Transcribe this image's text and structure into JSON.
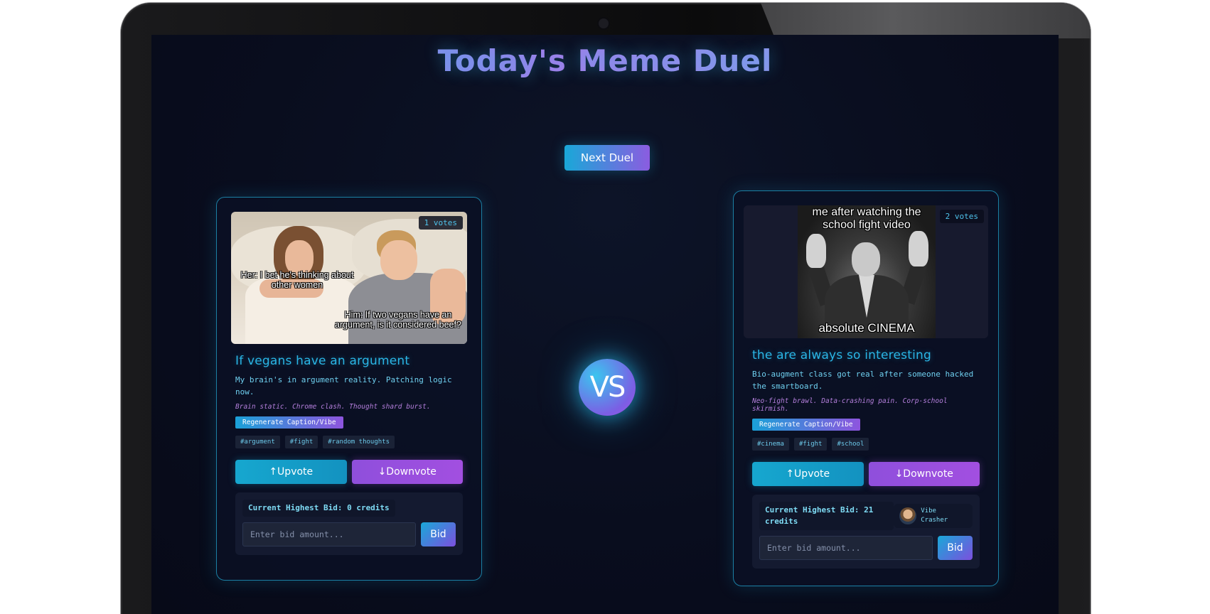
{
  "page": {
    "title": "Today's Meme Duel",
    "next_duel_label": "Next Duel",
    "vs_label": "VS"
  },
  "colors": {
    "accent_cyan": "#2ab6e6",
    "accent_purple": "#a24fe0",
    "background": "#090d1e"
  },
  "duel": [
    {
      "votes_label": "1 votes",
      "image_caption_her": "Her: I bet he's thinking about other women",
      "image_caption_him": "Him: If two vegans have an argument, is it considered beef?",
      "title": "If vegans have an argument",
      "description": "My brain's in argument reality. Patching logic now.",
      "vibe": "Brain static. Chrome clash. Thought shard burst.",
      "regen_label": "Regenerate Caption/Vibe",
      "tags": [
        "#argument",
        "#fight",
        "#random thoughts"
      ],
      "upvote_label": "↑Upvote",
      "downvote_label": "↓Downvote",
      "bid_label": "Current Highest Bid: 0 credits",
      "bid_placeholder": "Enter bid amount...",
      "bid_button": "Bid"
    },
    {
      "votes_label": "2 votes",
      "image_caption_top": "me after watching the school fight video",
      "image_caption_bottom": "absolute CINEMA",
      "title": "the are always so interesting",
      "description": "Bio-augment class got real after someone hacked the smartboard.",
      "vibe": "Neo-fight brawl. Data-crashing pain. Corp-school skirmish.",
      "regen_label": "Regenerate Caption/Vibe",
      "tags": [
        "#cinema",
        "#fight",
        "#school"
      ],
      "upvote_label": "↑Upvote",
      "downvote_label": "↓Downvote",
      "bid_label": "Current Highest Bid: 21 credits",
      "top_bidder": "Vibe Crasher",
      "bid_placeholder": "Enter bid amount...",
      "bid_button": "Bid"
    }
  ]
}
